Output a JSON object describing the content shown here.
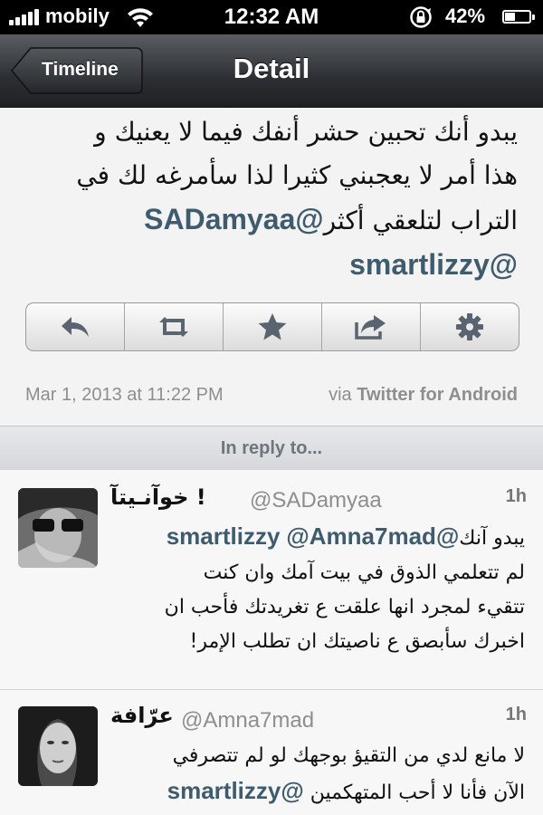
{
  "status_bar": {
    "carrier": "mobily",
    "time": "12:32 AM",
    "battery_pct": "42%",
    "battery_level": 0.42,
    "icons": [
      "signal-icon",
      "wifi-icon",
      "rotation-lock-icon",
      "battery-icon"
    ]
  },
  "nav": {
    "back_label": "Timeline",
    "title": "Detail"
  },
  "tweet": {
    "text_line1": "يبدو أنك تحبين حشر أنفك فيما لا يعنيك و",
    "text_line2": "هذا أمر لا يعجبني كثيرا لذا سأمرغه لك في",
    "text_line3_a": "التراب لتلعقي أكثر",
    "mention1": "@SADamyaa",
    "mention2": "@smartlizzy",
    "date": "Mar 1, 2013 at 11:22 PM",
    "via_prefix": "via",
    "via_app": "Twitter for Android",
    "actions": [
      "reply-icon",
      "retweet-icon",
      "favorite-icon",
      "share-icon",
      "gear-icon"
    ]
  },
  "in_reply_header": "In reply to...",
  "replies": [
    {
      "name": "خوآنـيتآ !",
      "handle": "@SADamyaa",
      "age": "1h",
      "line1_text": "يبدو آنك",
      "mention_a": "@Amna7mad",
      "mention_b": "@smartlizzy",
      "line2": "لم تتعلمي الذوق في بيت آمك وان كنت",
      "line3": "تتقيء لمجرد انها علقت ع تغريدتك فأحب ان",
      "line4": "اخبرك سأبصق ع ناصيتك ان تطلب الإمر!"
    },
    {
      "name": "عرّافة",
      "handle": "@Amna7mad",
      "age": "1h",
      "line1": "لا مانع لدي من التقيؤ بوجهك لو لم تتصرفي",
      "line2_text": "الآن  فأنا لا أحب المتهكمين",
      "mention": "@smartlizzy"
    }
  ],
  "colors": {
    "mention": "#3f5b6e",
    "nav_dark": "#2c2f33",
    "meta_gray": "#8e8e8e"
  }
}
